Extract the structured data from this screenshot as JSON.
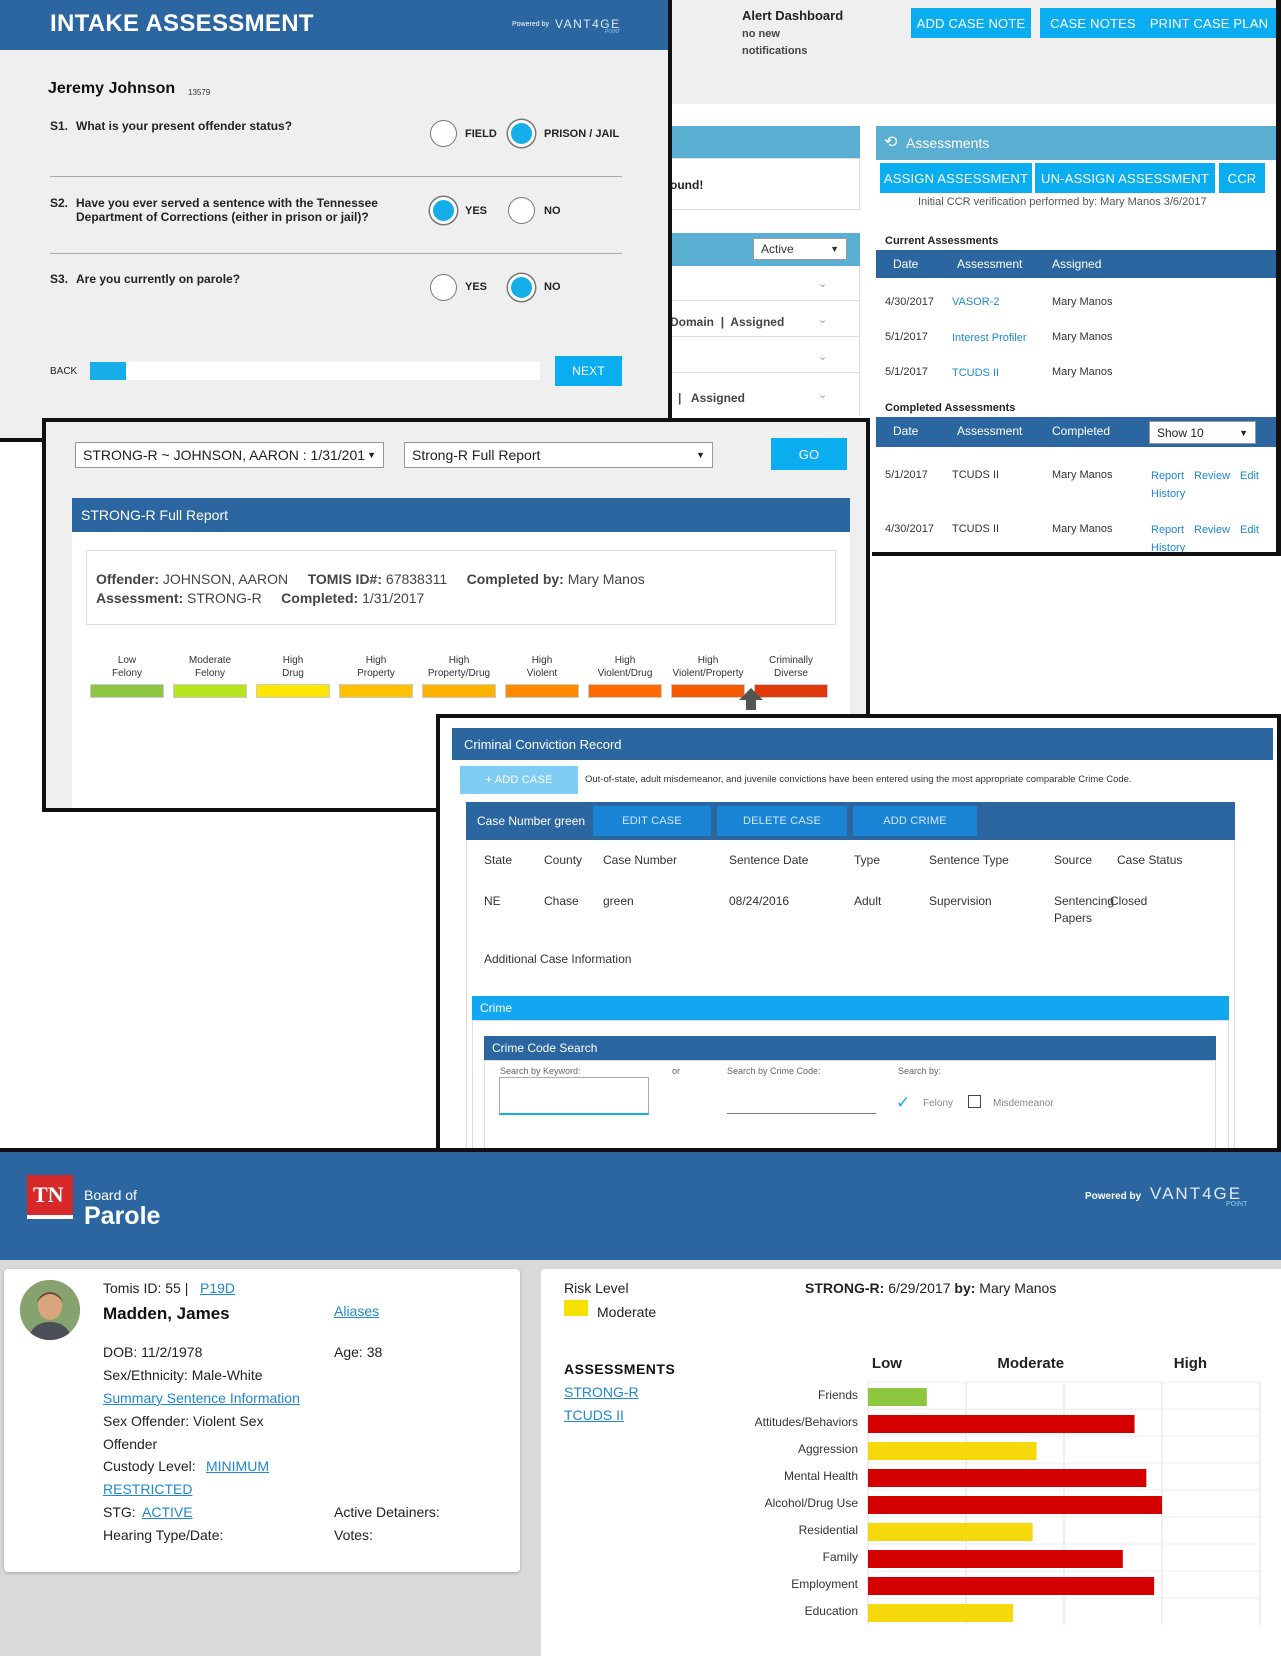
{
  "intake": {
    "title": "INTAKE ASSESSMENT",
    "powered": "Powered by",
    "brand": "VANT4GE",
    "brand_sub": "POINT",
    "name": "Jeremy Johnson",
    "id": "13579",
    "q1_num": "S1.",
    "q1": "What is your present offender status?",
    "q1_a": "FIELD",
    "q1_b": "PRISON / JAIL",
    "q2_num": "S2.",
    "q2_l1": "Have you ever served a sentence with the Tennessee",
    "q2_l2": "Department of Corrections (either in prison or jail)?",
    "q2_a": "YES",
    "q2_b": "NO",
    "q3_num": "S3.",
    "q3": "Are you currently on parole?",
    "q3_a": "YES",
    "q3_b": "NO",
    "back": "BACK",
    "next": "NEXT",
    "progress": 0.08
  },
  "dash": {
    "alert_title": "Alert Dashboard",
    "alert_l1": "no new",
    "alert_l2": "notifications",
    "add_note": "ADD CASE NOTE",
    "case_notes": "CASE NOTES",
    "print_plan": "PRINT CASE PLAN",
    "found": "ound!",
    "active": "Active",
    "domain": "Domain",
    "sep": "|",
    "assigned": "Assigned",
    "assess_title": "Assessments",
    "assign": "ASSIGN ASSESSMENT",
    "unassign": "UN-ASSIGN ASSESSMENT",
    "ccr": "CCR",
    "ccr_note": "Initial CCR verification performed by: Mary Manos 3/6/2017",
    "current_title": "Current Assessments",
    "cols_current": [
      "Date",
      "Assessment",
      "Assigned"
    ],
    "current_rows": [
      [
        "4/30/2017",
        "VASOR-2",
        "Mary Manos"
      ],
      [
        "5/1/2017",
        "Interest Profiler",
        "Mary Manos"
      ],
      [
        "5/1/2017",
        "TCUDS II",
        "Mary Manos"
      ]
    ],
    "completed_title": "Completed Assessments",
    "cols_completed": [
      "Date",
      "Assessment",
      "Completed"
    ],
    "show": "Show 10",
    "completed_rows": [
      [
        "5/1/2017",
        "TCUDS II",
        "Mary Manos"
      ],
      [
        "4/30/2017",
        "TCUDS II",
        "Mary Manos"
      ]
    ],
    "actions": [
      "Report",
      "Review",
      "Edit"
    ],
    "history": "History"
  },
  "strong": {
    "sel1": "STRONG-R ~ JOHNSON, AARON : 1/31/201",
    "sel2": "Strong-R Full Report",
    "go": "GO",
    "title": "STRONG-R Full Report",
    "off_l": "Offender:",
    "off_v": "JOHNSON, AARON",
    "tomis_l": "TOMIS ID#:",
    "tomis_v": "67838311",
    "comp_by_l": "Completed by:",
    "comp_by_v": "Mary Manos",
    "assess_l": "Assessment:",
    "assess_v": "STRONG-R",
    "comp_l": "Completed:",
    "comp_v": "1/31/2017",
    "levels": [
      [
        "Low",
        "Felony"
      ],
      [
        "Moderate",
        "Felony"
      ],
      [
        "High",
        "Drug"
      ],
      [
        "High",
        "Property"
      ],
      [
        "High",
        "Property/Drug"
      ],
      [
        "High",
        "Violent"
      ],
      [
        "High",
        "Violent/Drug"
      ],
      [
        "High",
        "Violent/Property"
      ],
      [
        "Criminally",
        "Diverse"
      ]
    ],
    "level_colors": [
      "#8dc63f",
      "#b5e61d",
      "#ffe600",
      "#ffc000",
      "#ffb300",
      "#ff8a00",
      "#ff6a00",
      "#f55a00",
      "#e03a0a"
    ],
    "selected_level": "Criminally Diverse"
  },
  "ccr": {
    "title": "Criminal Conviction Record",
    "add_case": "+ ADD CASE",
    "note": "Out-of-state, adult misdemeanor, and juvenile convictions have been entered using the most appropriate comparable Crime Code.",
    "case_label": "Case Number green",
    "edit": "EDIT CASE",
    "del": "DELETE CASE",
    "add_crime": "ADD CRIME",
    "cols": [
      "State",
      "County",
      "Case Number",
      "Sentence Date",
      "Type",
      "Sentence Type",
      "Source",
      "Case Status"
    ],
    "row": [
      "NE",
      "Chase",
      "green",
      "08/24/2016",
      "Adult",
      "Supervision",
      "Sentencing",
      "Closed"
    ],
    "row_extra": "Papers",
    "additional": "Additional Case Information",
    "crime": "Crime",
    "search_title": "Crime Code Search",
    "kw": "Search by Keyword:",
    "or": "or",
    "code": "Search by Crime Code:",
    "by": "Search by:",
    "felony": "Felony",
    "misd": "Misdemeanor"
  },
  "parole": {
    "tn": "TN",
    "board": "Board of",
    "parole": "Parole",
    "powered": "Powered by",
    "brand": "VANT4GE",
    "brand_sub": "POINT",
    "tomis": "Tomis ID: 55 |",
    "tomis_link": "P19D",
    "name": "Madden, James",
    "aliases": "Aliases",
    "dob": "DOB: 11/2/1978",
    "age": "Age: 38",
    "sex": "Sex/Ethnicity: Male-White",
    "summary": "Summary Sentence Information",
    "so1": "Sex Offender: Violent Sex",
    "so2": "Offender",
    "custody": "Custody Level:",
    "custody_v1": "MINIMUM",
    "custody_v2": "RESTRICTED",
    "stg": "STG:",
    "stg_v": "ACTIVE",
    "detainers": "Active Detainers:",
    "hearing": "Hearing Type/Date:",
    "votes": "Votes:",
    "risk": "Risk Level",
    "risk_v": "Moderate",
    "strong_l": "STRONG-R:",
    "strong_v": "6/29/2017",
    "by_l": "by:",
    "by_v": "Mary Manos",
    "assess_h": "ASSESSMENTS",
    "a1": "STRONG-R",
    "a2": "TCUDS II"
  },
  "chart_data": {
    "type": "bar",
    "orientation": "horizontal",
    "x_labels": [
      "Low",
      "Moderate",
      "High"
    ],
    "categories": [
      "Friends",
      "Attitudes/Behaviors",
      "Aggression",
      "Mental Health",
      "Alcohol/Drug Use",
      "Residential",
      "Family",
      "Employment",
      "Education"
    ],
    "values": [
      0.15,
      0.68,
      0.43,
      0.71,
      0.75,
      0.42,
      0.65,
      0.73,
      0.37
    ],
    "levels": [
      "Low",
      "High",
      "Moderate",
      "High",
      "High",
      "Moderate",
      "High",
      "High",
      "Moderate"
    ],
    "colors": {
      "Low": "#8dc63f",
      "Moderate": "#f5d90a",
      "High": "#d40000"
    }
  }
}
